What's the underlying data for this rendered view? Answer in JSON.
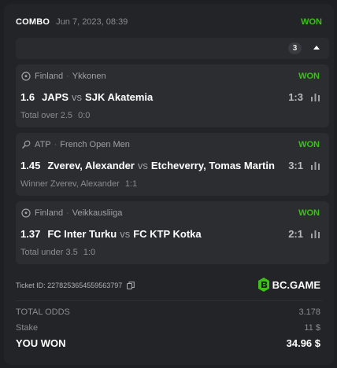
{
  "header": {
    "type_label": "COMBO",
    "date": "Jun 7, 2023, 08:39",
    "status": "WON"
  },
  "legs_toggle": {
    "count": "3",
    "icon": "caret-up-icon"
  },
  "bets": [
    {
      "sport_icon": "soccer-ball-icon",
      "country": "Finland",
      "competition": "Ykkonen",
      "status": "WON",
      "odds": "1.6",
      "home": "JAPS",
      "vs": "vs",
      "away": "SJK Akatemia",
      "score": "1:3",
      "selection": "Total over 2.5",
      "selection_score": "0:0"
    },
    {
      "sport_icon": "tennis-racket-icon",
      "country": "ATP",
      "competition": "French Open Men",
      "status": "WON",
      "odds": "1.45",
      "home": "Zverev, Alexander",
      "vs": "vs",
      "away": "Etcheverry, Tomas Martin",
      "score": "3:1",
      "selection": "Winner Zverev, Alexander",
      "selection_score": "1:1"
    },
    {
      "sport_icon": "soccer-ball-icon",
      "country": "Finland",
      "competition": "Veikkausliiga",
      "status": "WON",
      "odds": "1.37",
      "home": "FC Inter Turku",
      "vs": "vs",
      "away": "FC KTP Kotka",
      "score": "2:1",
      "selection": "Total under 3.5",
      "selection_score": "1:0"
    }
  ],
  "ticket": {
    "label": "Ticket ID: 2278253654559563797",
    "brand": "BC.GAME"
  },
  "summary": {
    "total_odds_label": "TOTAL ODDS",
    "total_odds_value": "3.178",
    "stake_label": "Stake",
    "stake_value": "11 $",
    "won_label": "YOU WON",
    "won_value": "34.96 $"
  },
  "colors": {
    "accent_green": "#3bc117",
    "background": "#1e1f22",
    "card": "#2c2d31"
  }
}
